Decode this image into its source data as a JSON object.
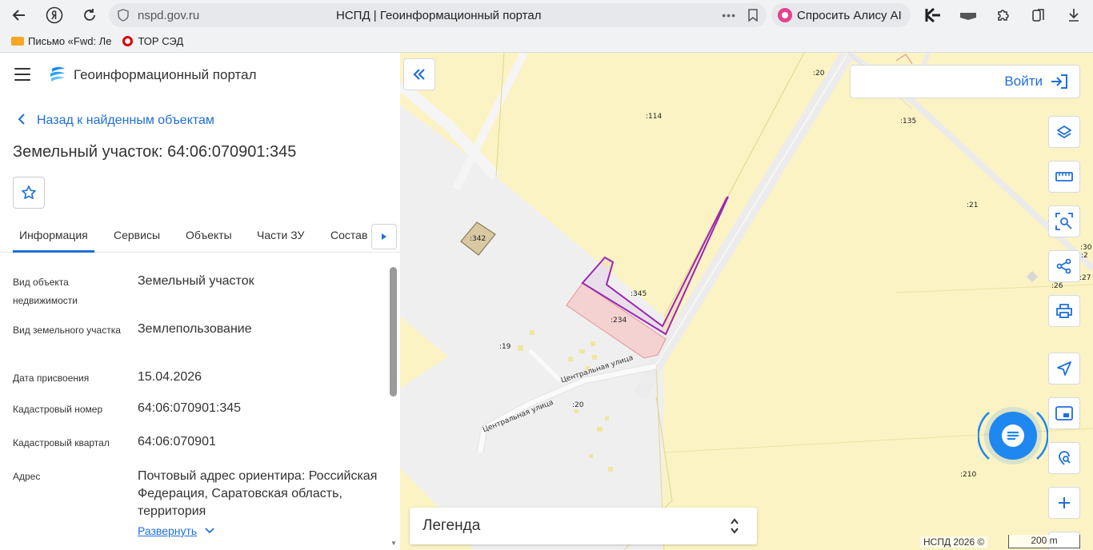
{
  "browser": {
    "url": "nspd.gov.ru",
    "tab_title": "НСПД | Геоинформационный портал",
    "alisa_label": "Спросить Алису AI",
    "bookmarks": [
      {
        "label": "Письмо «Fwd: Ле"
      },
      {
        "label": "ТОР СЭД"
      }
    ]
  },
  "panel": {
    "app_title": "Геоинформационный портал",
    "back_label": "Назад к найденным объектам",
    "object_title": "Земельный участок: 64:06:070901:345",
    "tabs": [
      {
        "label": "Информация",
        "active": true
      },
      {
        "label": "Сервисы"
      },
      {
        "label": "Объекты"
      },
      {
        "label": "Части ЗУ"
      },
      {
        "label": "Состав"
      }
    ],
    "properties": [
      {
        "label": "Вид объекта недвижимости",
        "value": "Земельный участок"
      },
      {
        "label": "Вид земельного участка",
        "value": "Землепользование"
      },
      {
        "label": "Дата присвоения",
        "value": "15.04.2026"
      },
      {
        "label": "Кадастровый номер",
        "value": "64:06:070901:345"
      },
      {
        "label": "Кадастровый квартал",
        "value": "64:06:070901"
      },
      {
        "label": "Адрес",
        "value": "Почтовый адрес ориентира: Российская Федерация, Саратовская область, территория"
      }
    ],
    "expand_label": "Развернуть"
  },
  "map": {
    "login_label": "Войти",
    "legend_label": "Легенда",
    "copyright": "НСПД 2026 ©",
    "scale_label": "200 m",
    "parcel_labels": [
      ":20",
      ":114",
      ":135",
      ":21",
      ":342",
      ":345",
      ":234",
      ":19",
      ":20",
      ":210",
      ":30",
      ":2",
      ":27",
      ":26"
    ],
    "street_names": [
      "Центральная улица",
      "Центральная улица"
    ],
    "colors": {
      "background": "#fbf3c3",
      "road": "#eeeeee",
      "selected_parcel": "#9c27b0",
      "parcel_234": "#f4c2c2",
      "accent": "#1e6fd9"
    }
  }
}
